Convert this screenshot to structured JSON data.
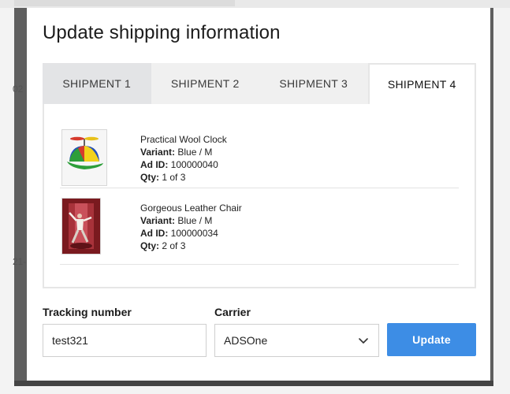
{
  "background": {
    "peek_text_1": "02",
    "peek_text_2": "21-"
  },
  "modal": {
    "title": "Update shipping information",
    "tabs": [
      {
        "label": "SHIPMENT 1",
        "active": false
      },
      {
        "label": "SHIPMENT 2",
        "active": false
      },
      {
        "label": "SHIPMENT 3",
        "active": false
      },
      {
        "label": "SHIPMENT 4",
        "active": true
      }
    ],
    "items": [
      {
        "name": "Practical Wool Clock",
        "variant_label": "Variant:",
        "variant": "Blue / M",
        "ad_id_label": "Ad ID:",
        "ad_id": "100000040",
        "qty_label": "Qty:",
        "qty": "1 of 3",
        "image": "propeller-cap-photo"
      },
      {
        "name": "Gorgeous Leather Chair",
        "variant_label": "Variant:",
        "variant": "Blue / M",
        "ad_id_label": "Ad ID:",
        "ad_id": "100000034",
        "qty_label": "Qty:",
        "qty": "2 of 3",
        "image": "dancer-hallway-photo"
      }
    ],
    "form": {
      "tracking_label": "Tracking number",
      "tracking_value": "test321",
      "carrier_label": "Carrier",
      "carrier_value": "ADSOne",
      "update_label": "Update"
    }
  },
  "colors": {
    "accent": "#3d8de5",
    "tab_inactive": "#f0f0f0",
    "tab_first": "#e3e4e6",
    "panel_border": "#e6e6e6"
  }
}
